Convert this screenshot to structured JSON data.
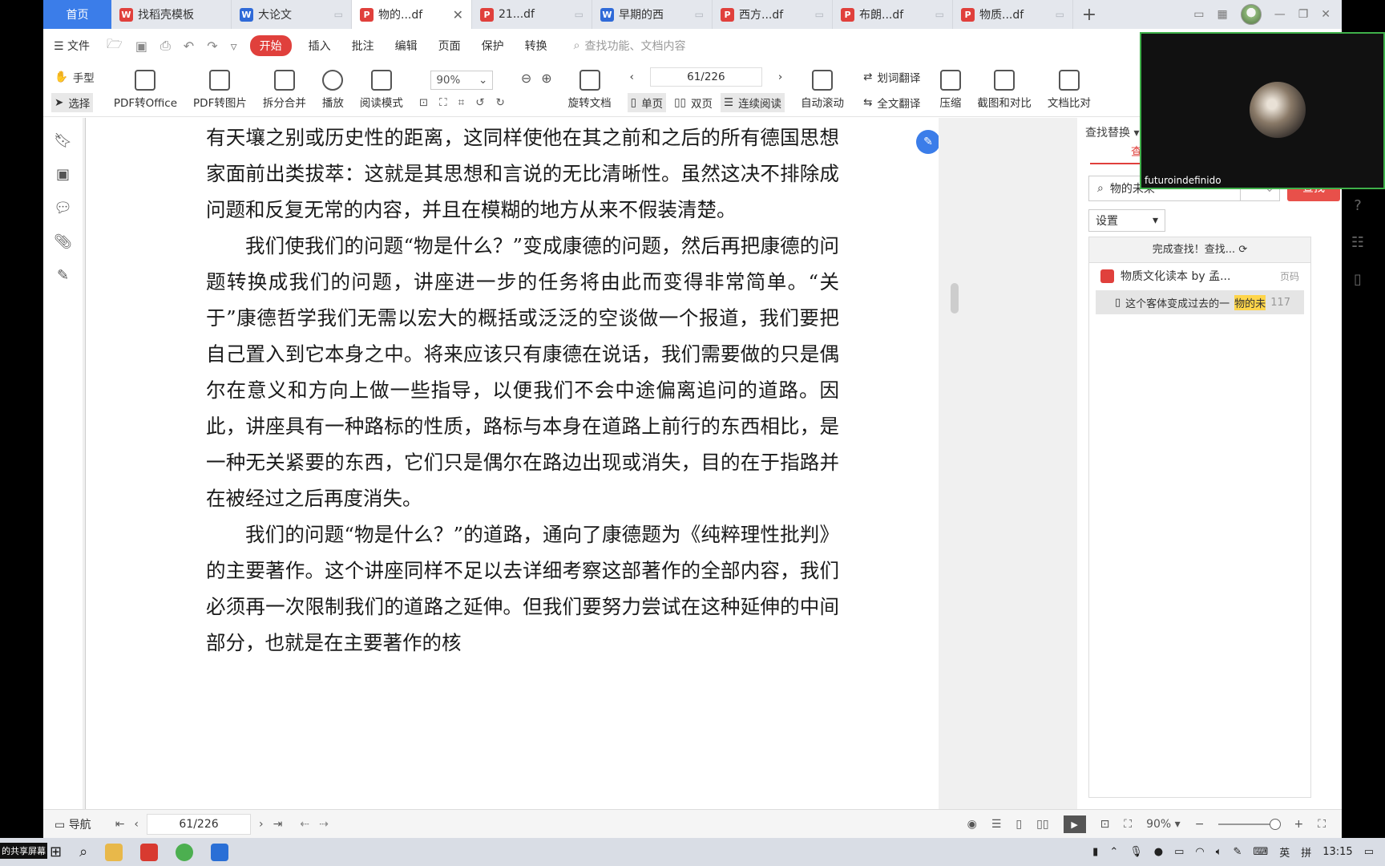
{
  "tabs": [
    {
      "label": "首页",
      "kind": "home"
    },
    {
      "label": "找稻壳模板",
      "icon": "wps-icon",
      "color": "red"
    },
    {
      "label": "大论文",
      "icon": "word-icon",
      "color": "blue"
    },
    {
      "label": "物的...df",
      "icon": "pdf-icon",
      "color": "red",
      "active": true
    },
    {
      "label": "21...df",
      "icon": "pdf-icon",
      "color": "red"
    },
    {
      "label": "早期的西",
      "icon": "word-icon",
      "color": "blue"
    },
    {
      "label": "西方...df",
      "icon": "pdf-icon",
      "color": "red"
    },
    {
      "label": "布朗...df",
      "icon": "pdf-icon",
      "color": "red"
    },
    {
      "label": "物质...df",
      "icon": "pdf-icon",
      "color": "red"
    }
  ],
  "menu": {
    "file": "文件",
    "items": [
      "开始",
      "插入",
      "批注",
      "编辑",
      "页面",
      "保护",
      "转换"
    ],
    "search_placeholder": "查找功能、文档内容"
  },
  "ribbon": {
    "hand": "手型",
    "select": "选择",
    "pdf_to_office": "PDF转Office",
    "pdf_to_image": "PDF转图片",
    "split_merge": "拆分合并",
    "play": "播放",
    "read_mode": "阅读模式",
    "zoom": "90%",
    "page": "61/226",
    "rotate": "旋转文档",
    "single": "单页",
    "double": "双页",
    "continuous": "连续阅读",
    "autoscroll": "自动滚动",
    "word_translate": "划词翻译",
    "full_translate": "全文翻译",
    "compress": "压缩",
    "screenshot_compare": "截图和对比",
    "doc_compare": "文档比对"
  },
  "document": {
    "paragraphs": [
      {
        "indent": false,
        "text": "有天壤之别或历史性的距离，这同样使他在其之前和之后的所有德国思想家面前出类拔萃：这就是其思想和言说的无比清晰性。虽然这决不排除成问题和反复无常的内容，并且在模糊的地方从来不假装清楚。"
      },
      {
        "indent": true,
        "text": "我们使我们的问题“物是什么？”变成康德的问题，然后再把康德的问题转换成我们的问题，讲座进一步的任务将由此而变得非常简单。“关于”康德哲学我们无需以宏大的概括或泛泛的空谈做一个报道，我们要把自己置入到它本身之中。将来应该只有康德在说话，我们需要做的只是偶尔在意义和方向上做一些指导，以便我们不会中途偏离追问的道路。因此，讲座具有一种路标的性质，路标与本身在道路上前行的东西相比，是一种无关紧要的东西，它们只是偶尔在路边出现或消失，目的在于指路并在被经过之后再度消失。"
      },
      {
        "indent": true,
        "text": "我们的问题“物是什么？”的道路，通向了康德题为《纯粹理性批判》的主要著作。这个讲座同样不足以去详细考察这部著作的全部内容，我们必须再一次限制我们的道路之延伸。但我们要努力尝试在这种延伸的中间部分，也就是在主要著作的核"
      }
    ]
  },
  "find_panel": {
    "title": "查找替换",
    "tab": "查找",
    "query": "物的未来",
    "button": "查找",
    "settings": "设置",
    "status": "完成查找！查找...",
    "result_file": "物质文化读本 by 孟...",
    "page_label": "页码",
    "hit_prefix": "这个客体变成过去的一",
    "hit_match": "物的未",
    "hit_page": "117"
  },
  "statusbar": {
    "nav": "导航",
    "page": "61/226",
    "zoom": "90%"
  },
  "video": {
    "name": "futuroindefinido"
  },
  "taskbar": {
    "share": "的共享屏幕",
    "lang": "英",
    "ime": "拼",
    "time": "13:15"
  },
  "colors": {
    "accent": "#e0403c",
    "home_tab": "#3b7de9",
    "video_border": "#3fb04a"
  }
}
